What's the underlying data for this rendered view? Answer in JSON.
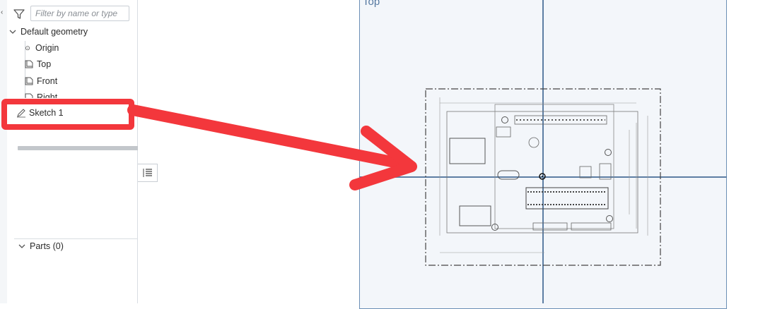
{
  "feature_panel": {
    "filter_placeholder": "Filter by name or type",
    "default_geometry_label": "Default geometry",
    "planes": [
      {
        "label": "Origin",
        "icon": "origin-point-icon"
      },
      {
        "label": "Top",
        "icon": "plane-icon"
      },
      {
        "label": "Front",
        "icon": "plane-icon"
      },
      {
        "label": "Right",
        "icon": "plane-icon"
      }
    ],
    "sketch_label": "Sketch 1",
    "parts_label": "Parts (0)"
  },
  "viewport": {
    "plane_label": "Top"
  },
  "annotation": {
    "arrow_color": "#f3373c"
  }
}
